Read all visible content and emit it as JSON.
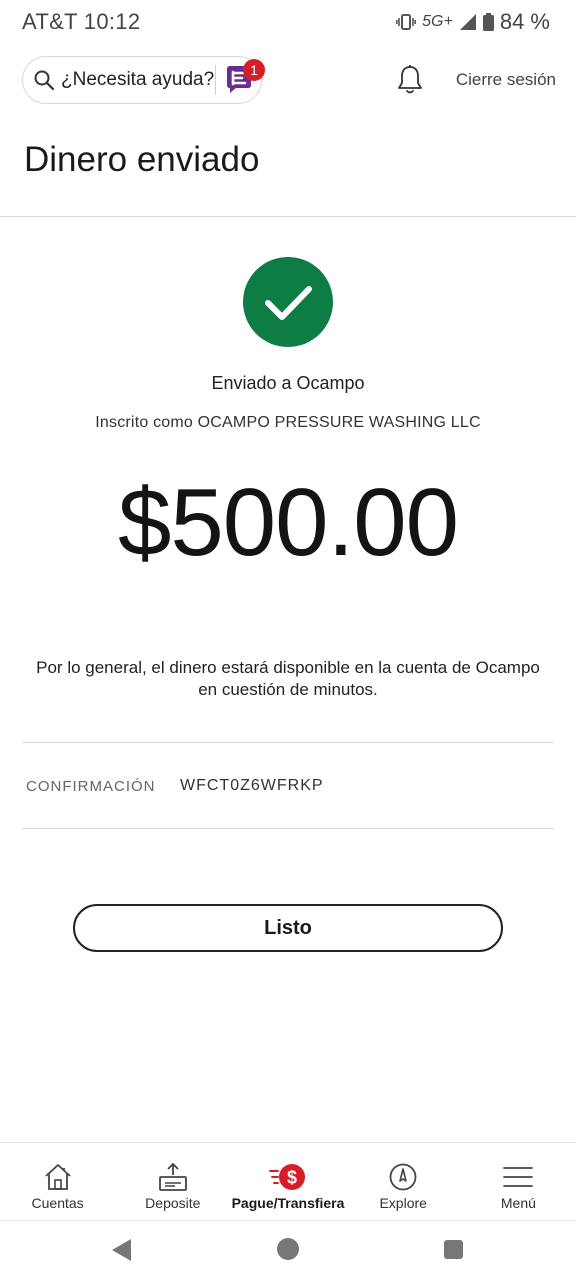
{
  "status_bar": {
    "carrier_time": "AT&T  10:12",
    "network": "5G+",
    "battery": "84 %"
  },
  "header": {
    "help_text": "¿Necesita ayuda?",
    "chat_badge": "1",
    "logout": "Cierre sesión"
  },
  "page": {
    "title": "Dinero enviado"
  },
  "confirmation": {
    "sent_to": "Enviado a Ocampo",
    "enrolled_as": "Inscrito como OCAMPO PRESSURE WASHING LLC",
    "amount": "$500.00",
    "note_line1": "Por lo general, el dinero estará disponible en la cuenta de Ocampo",
    "note_line2": "en cuestión de minutos.",
    "label": "CONFIRMACIÓN",
    "code": "WFCT0Z6WFRKP"
  },
  "actions": {
    "done": "Listo"
  },
  "bottom_nav": {
    "items": [
      {
        "label": "Cuentas",
        "icon": "home-icon"
      },
      {
        "label": "Deposite",
        "icon": "deposit-icon"
      },
      {
        "label": "Pague/Transfiera",
        "icon": "pay-transfer-icon",
        "active": true
      },
      {
        "label": "Explore",
        "icon": "compass-icon"
      },
      {
        "label": "Menú",
        "icon": "menu-icon"
      }
    ]
  },
  "colors": {
    "success": "#0e7c45",
    "brand_red": "#d71e28",
    "chat_purple": "#6b2c91"
  }
}
